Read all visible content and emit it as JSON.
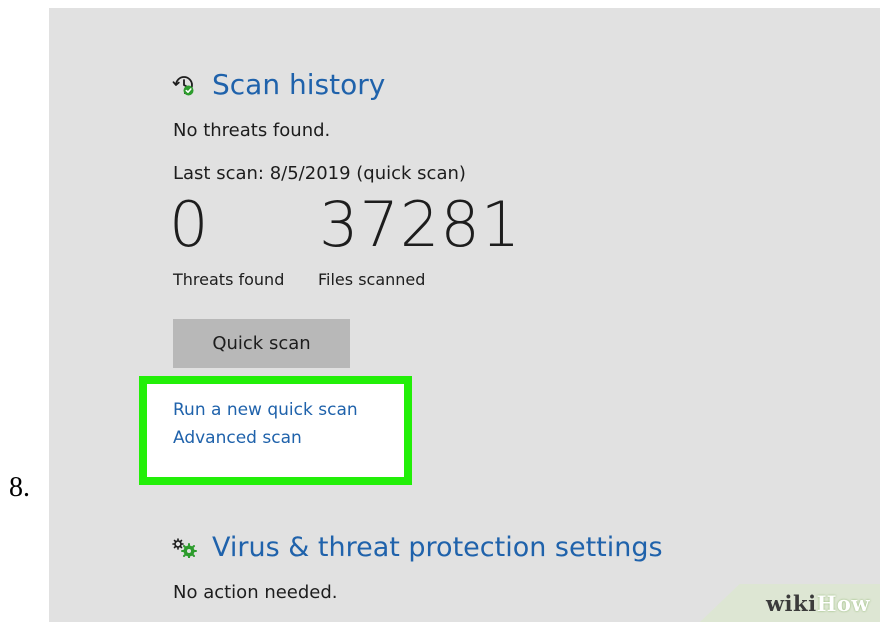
{
  "step_number": "8.",
  "scan_history": {
    "icon": "clock-history-icon",
    "title": "Scan history",
    "status": "No threats found.",
    "last_scan": "Last scan: 8/5/2019 (quick scan)",
    "threats_found": "0",
    "threats_found_label": "Threats found",
    "files_scanned": "37281",
    "files_scanned_label": "Files scanned"
  },
  "quick_scan_button": "Quick scan",
  "links": {
    "run_new_quick_scan": "Run a new quick scan",
    "advanced_scan": "Advanced scan"
  },
  "settings_section": {
    "icon": "gears-icon",
    "title": "Virus & threat protection settings",
    "status": "No action needed."
  },
  "watermark": {
    "part1": "wiki",
    "part2": "How"
  },
  "colors": {
    "panel_background": "#e1e1e1",
    "accent_blue": "#1f62ab",
    "highlight_green": "#22ef08",
    "button_gray": "#b8b8b8",
    "status_green": "#2d9c2d"
  }
}
